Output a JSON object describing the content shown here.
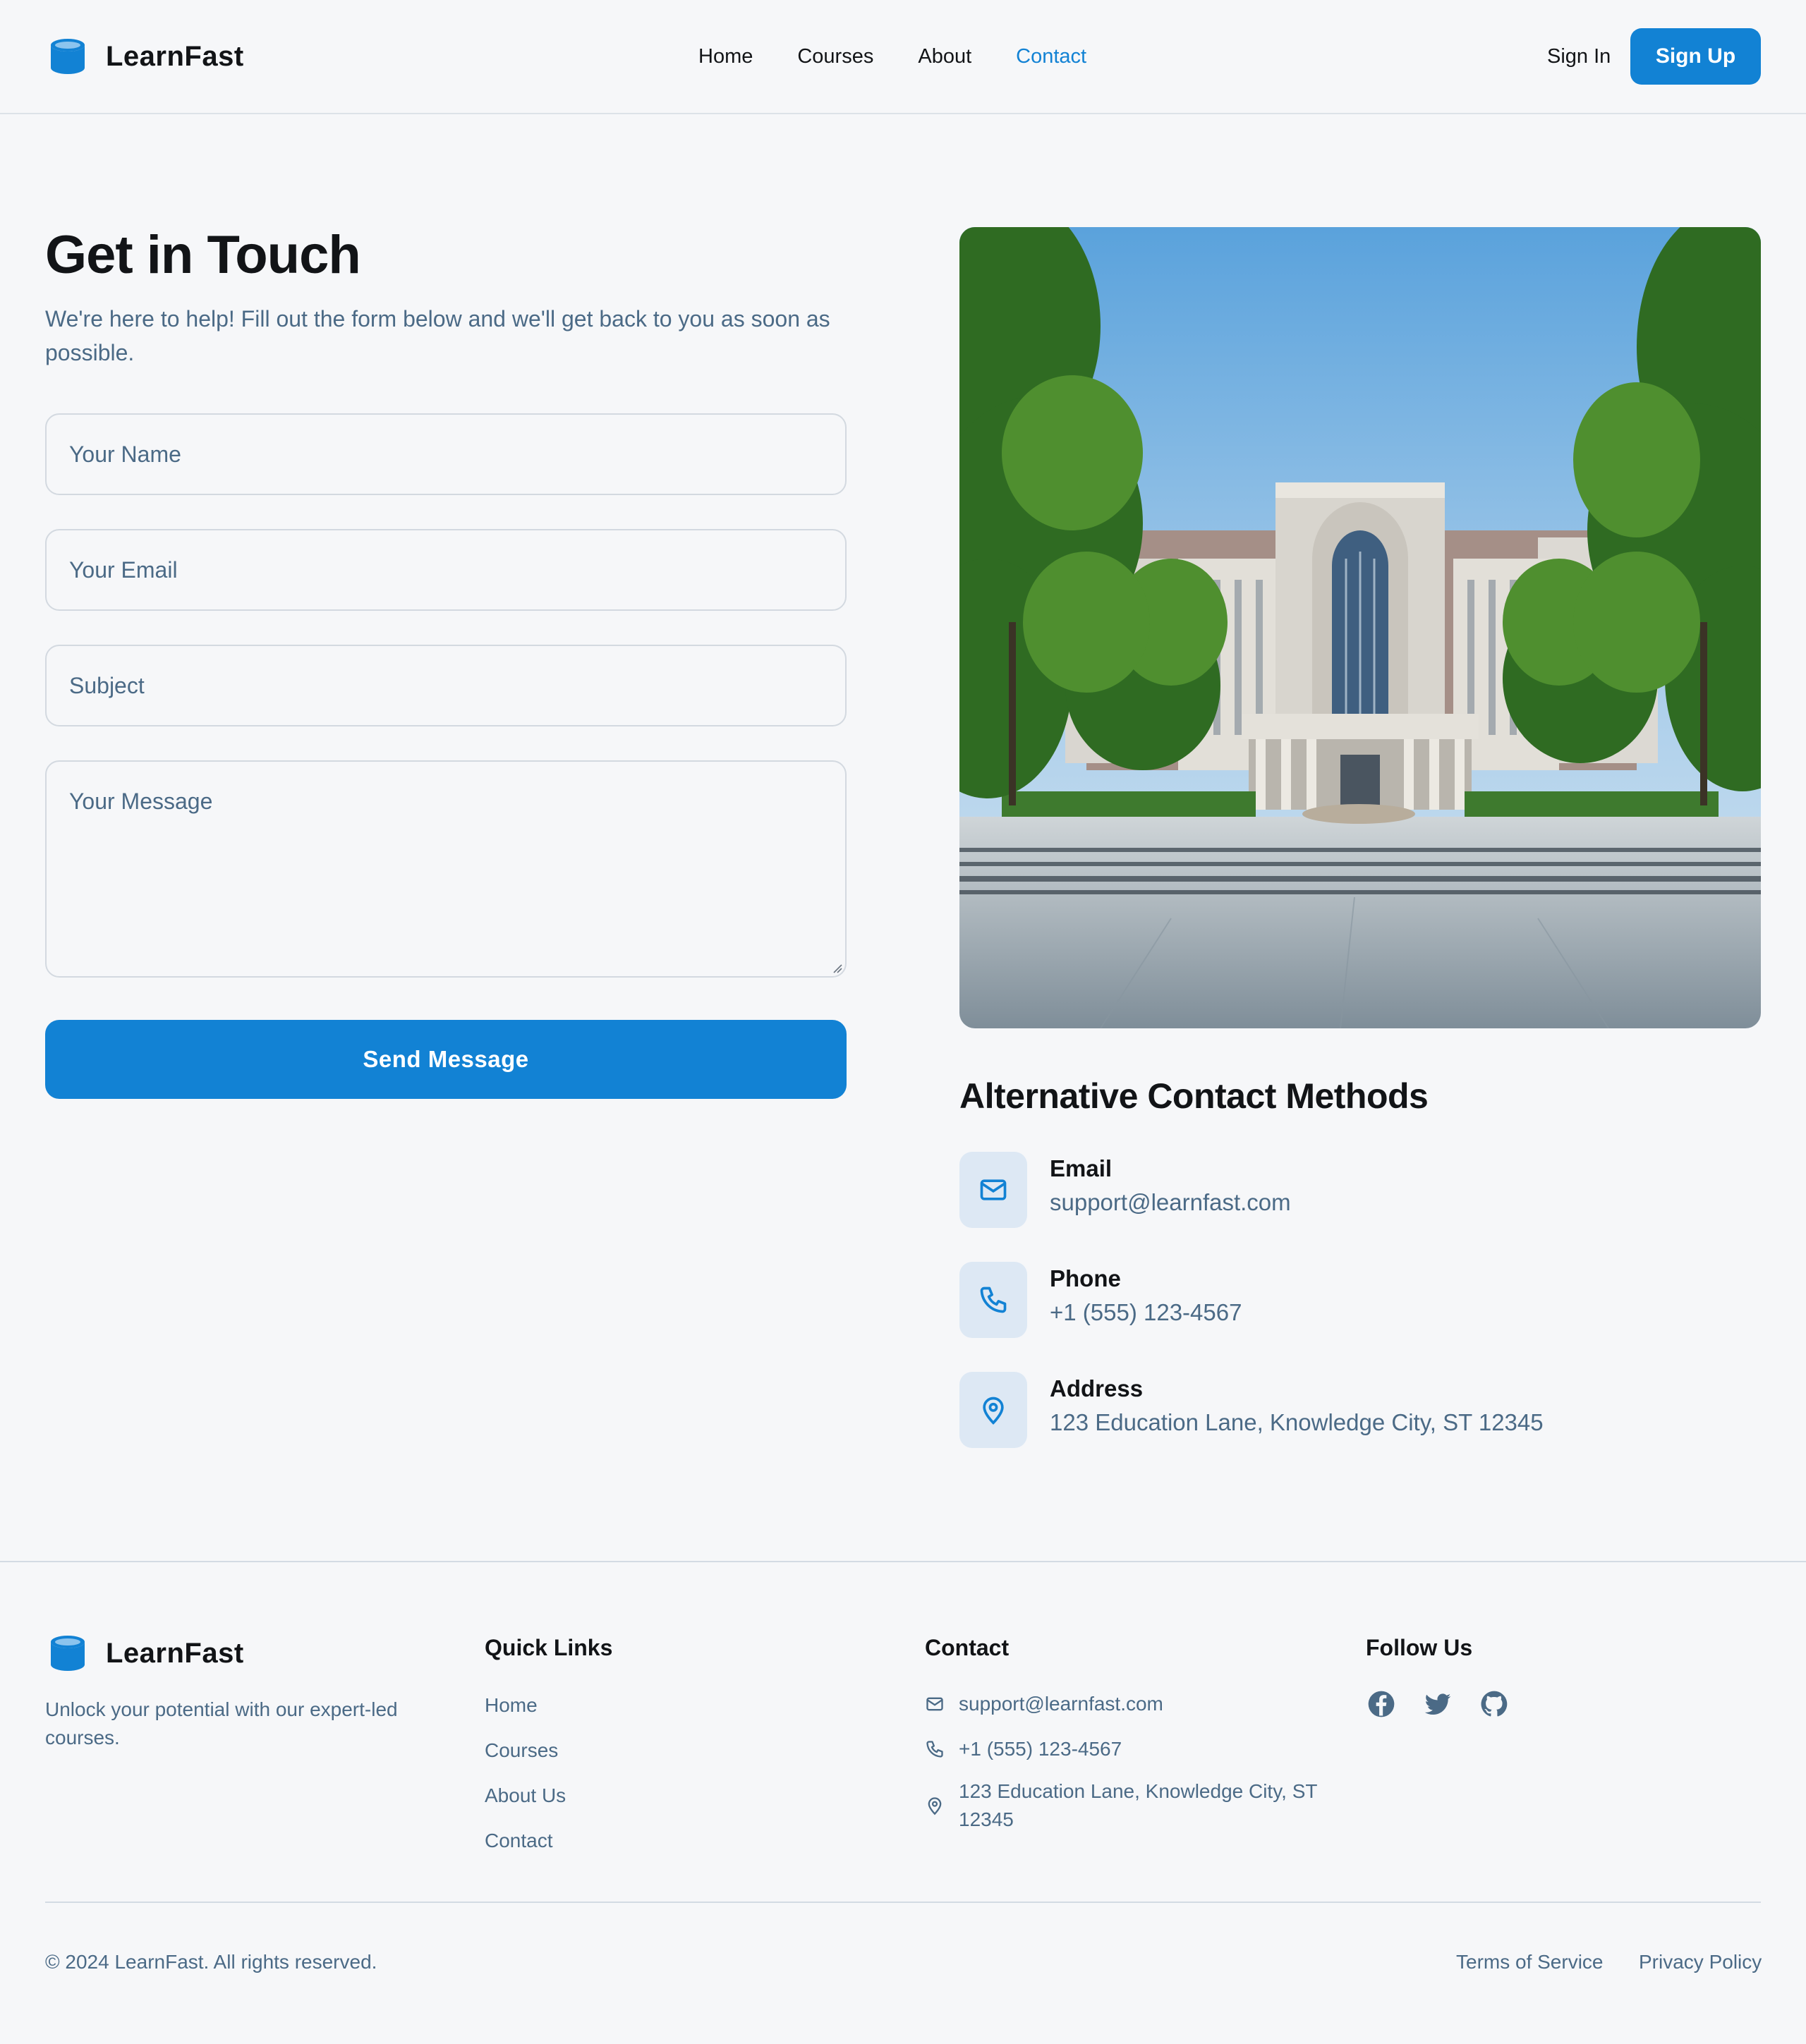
{
  "brand": {
    "name": "LearnFast",
    "accent": "#1282d4"
  },
  "nav": {
    "items": [
      {
        "label": "Home",
        "active": false
      },
      {
        "label": "Courses",
        "active": false
      },
      {
        "label": "About",
        "active": false
      },
      {
        "label": "Contact",
        "active": true
      }
    ],
    "signin_label": "Sign In",
    "signup_label": "Sign Up"
  },
  "contact_form": {
    "title": "Get in Touch",
    "subtitle": "We're here to help! Fill out the form below and we'll get back to you as soon as possible.",
    "name_placeholder": "Your Name",
    "email_placeholder": "Your Email",
    "subject_placeholder": "Subject",
    "message_placeholder": "Your Message",
    "submit_label": "Send Message"
  },
  "alternative": {
    "title": "Alternative Contact Methods",
    "methods": [
      {
        "icon": "mail-icon",
        "label": "Email",
        "value": "support@learnfast.com"
      },
      {
        "icon": "phone-icon",
        "label": "Phone",
        "value": "+1 (555) 123-4567"
      },
      {
        "icon": "map-pin-icon",
        "label": "Address",
        "value": "123 Education Lane, Knowledge City, ST 12345"
      }
    ]
  },
  "footer": {
    "brand": "LearnFast",
    "tagline": "Unlock your potential with our expert-led courses.",
    "quick_links": {
      "heading": "Quick Links",
      "items": [
        "Home",
        "Courses",
        "About Us",
        "Contact"
      ]
    },
    "contact": {
      "heading": "Contact",
      "email": "support@learnfast.com",
      "phone": "+1 (555) 123-4567",
      "address": "123 Education Lane, Knowledge City, ST 12345"
    },
    "follow": {
      "heading": "Follow Us",
      "icons": [
        "facebook-icon",
        "twitter-icon",
        "github-icon"
      ]
    },
    "copyright": "© 2024 LearnFast. All rights reserved.",
    "terms_label": "Terms of Service",
    "privacy_label": "Privacy Policy"
  }
}
